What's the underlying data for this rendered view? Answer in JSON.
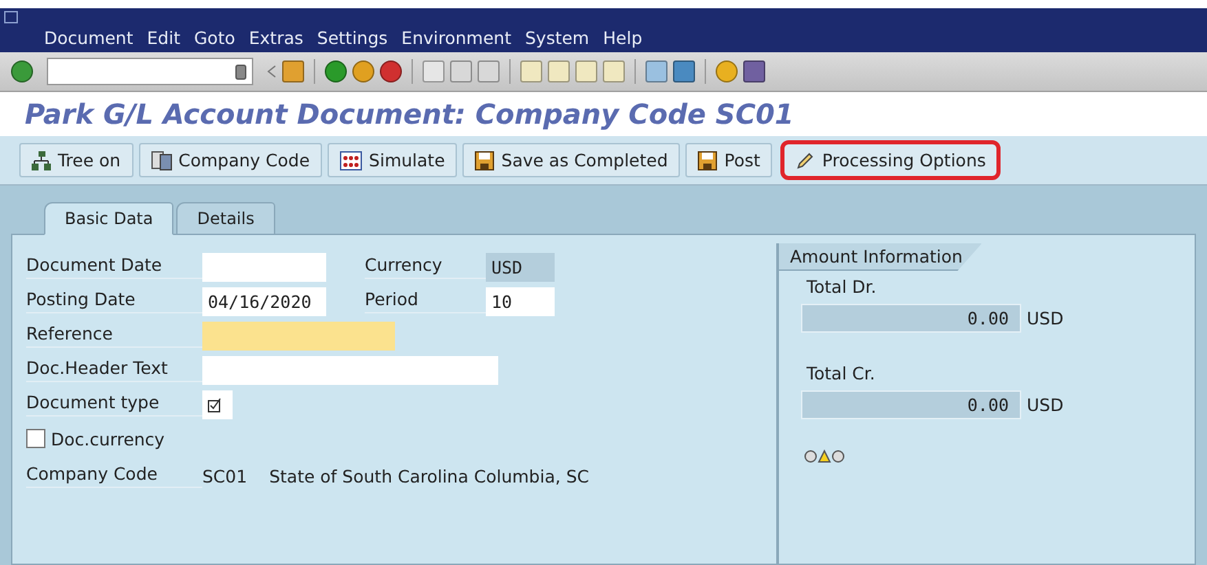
{
  "menu": [
    "Document",
    "Edit",
    "Goto",
    "Extras",
    "Settings",
    "Environment",
    "System",
    "Help"
  ],
  "title": "Park G/L Account Document: Company Code SC01",
  "app_toolbar": [
    {
      "label": "Tree on",
      "highlighted": false
    },
    {
      "label": "Company Code",
      "highlighted": false
    },
    {
      "label": "Simulate",
      "highlighted": false
    },
    {
      "label": "Save as Completed",
      "highlighted": false
    },
    {
      "label": "Post",
      "highlighted": false
    },
    {
      "label": "Processing Options",
      "highlighted": true
    }
  ],
  "tabs": [
    {
      "label": "Basic Data",
      "selected": true
    },
    {
      "label": "Details",
      "selected": false
    }
  ],
  "rows": [
    {
      "kind": "date",
      "label": "Document Date",
      "side": {
        "label": "Currency",
        "value": "USD",
        "editable": false
      }
    },
    {
      "kind": "date",
      "label": "Posting Date",
      "value": "04/16/2020",
      "side": {
        "label": "Period",
        "value": "10",
        "editable": true
      }
    },
    {
      "kind": "reference",
      "label": "Reference",
      "required": true
    },
    {
      "kind": "text",
      "label": "Doc.Header Text"
    },
    {
      "kind": "type",
      "label": "Document type"
    },
    {
      "kind": "checkbox",
      "label": "Doc.currency",
      "checked": false
    },
    {
      "kind": "company",
      "label": "Company Code",
      "code": "SC01",
      "name": "State of South Carolina Columbia, SC"
    }
  ],
  "amount_info": {
    "title": "Amount Information",
    "totals": [
      {
        "label": "Total Dr.",
        "value": "0.00",
        "currency": "USD"
      },
      {
        "label": "Total Cr.",
        "value": "0.00",
        "currency": "USD"
      }
    ]
  }
}
